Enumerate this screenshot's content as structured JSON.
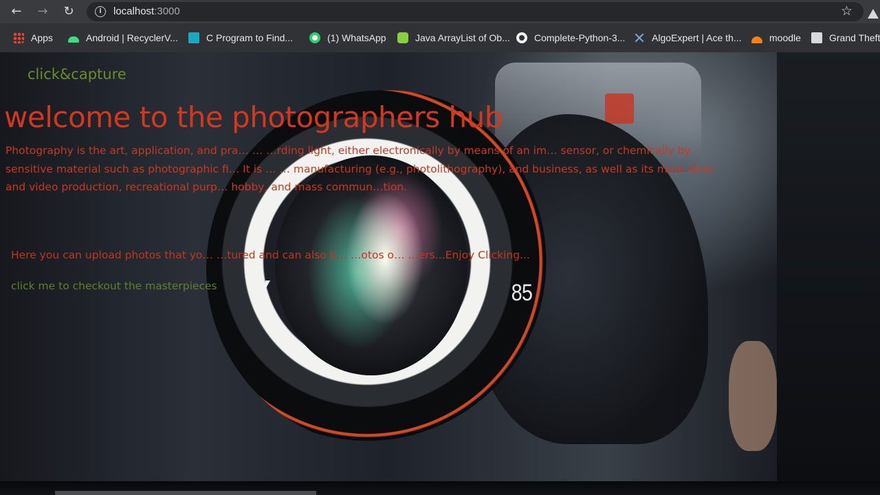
{
  "browser": {
    "back_icon": "←",
    "forward_icon": "→",
    "reload_icon": "↻",
    "url_host": "localhost",
    "url_port": ":3000",
    "bookmark_star_icon": "☆"
  },
  "bookmarks": [
    {
      "label": "Apps",
      "icon": "apps-grid-icon"
    },
    {
      "label": "Android | RecyclerV...",
      "icon": "android-icon"
    },
    {
      "label": "C Program to Find...",
      "icon": "site-favicon"
    },
    {
      "label": "(1) WhatsApp",
      "icon": "whatsapp-icon"
    },
    {
      "label": "Java ArrayList of Ob...",
      "icon": "site-favicon"
    },
    {
      "label": "Complete-Python-3...",
      "icon": "github-icon"
    },
    {
      "label": "AlgoExpert | Ace th...",
      "icon": "algoexpert-icon"
    },
    {
      "label": "moodle",
      "icon": "moodle-icon"
    },
    {
      "label": "Grand Theft A",
      "icon": "site-favicon"
    }
  ],
  "page": {
    "brand": "click&capture",
    "headline": "welcome to the photographers hub",
    "intro_lines": [
      "Photography is the art, application, and pra… … …rding light, either electronically by means of an im… sensor, or chemically by",
      "sensitive material such as photographic fi… It is … … manufacturing (e.g., photolithography), and business, as well as its more direc",
      "and video production, recreational purp… hobby, and mass commun…tion."
    ],
    "tagline": "Here you can upload photos that yo… …tured and can also b… …otos o… …ers...Enjoy Clicking...",
    "cta_link": "click me to checkout the masterpieces",
    "lens_marking": "85"
  }
}
